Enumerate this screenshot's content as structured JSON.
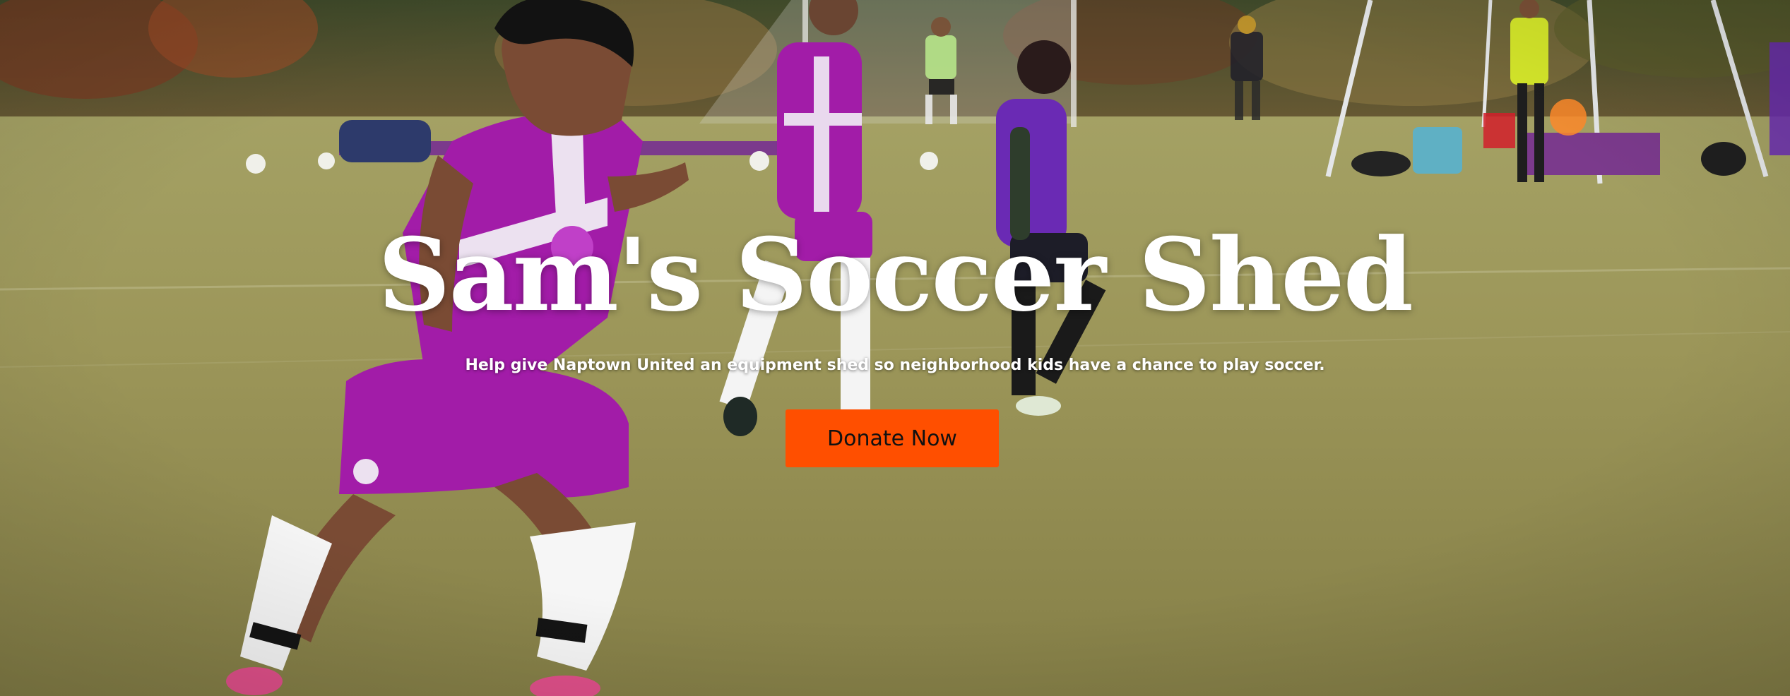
{
  "hero": {
    "title": "Sam's Soccer Shed",
    "subtitle": "Help give Naptown United an equipment shed so neighborhood kids have a chance to play soccer.",
    "cta_label": "Donate Now"
  },
  "colors": {
    "cta_background": "#ff4f00",
    "text": "#ffffff",
    "jersey": "#a21ca8",
    "grass": "#9a9458"
  },
  "background": {
    "description_icon": "soccer-field-photo"
  }
}
